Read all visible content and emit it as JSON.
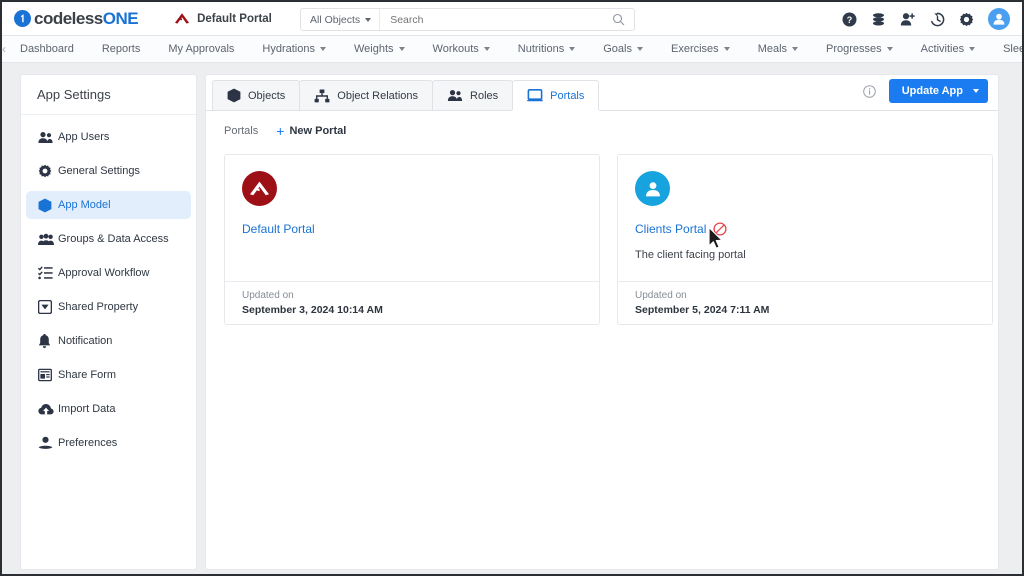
{
  "header": {
    "brand_prefix": "codeless",
    "brand_suffix": "ONE",
    "brand_mark": "1",
    "portal_name": "Default Portal",
    "portal_icon": "arrow-logo-icon",
    "search": {
      "scope": "All Objects",
      "placeholder": "Search",
      "value": "",
      "icon": "search-icon"
    },
    "icons": [
      {
        "name": "help-icon",
        "label": "Help"
      },
      {
        "name": "database-icon",
        "label": "Data"
      },
      {
        "name": "add-user-icon",
        "label": "Add User"
      },
      {
        "name": "history-icon",
        "label": "History"
      },
      {
        "name": "gear-icon",
        "label": "Settings"
      },
      {
        "name": "avatar-icon",
        "label": "Account"
      }
    ]
  },
  "nav": {
    "prev_arrow": "‹",
    "next_arrow": "›",
    "items": [
      {
        "label": "Dashboard",
        "dropdown": false
      },
      {
        "label": "Reports",
        "dropdown": false
      },
      {
        "label": "My Approvals",
        "dropdown": false
      },
      {
        "label": "Hydrations",
        "dropdown": true
      },
      {
        "label": "Weights",
        "dropdown": true
      },
      {
        "label": "Workouts",
        "dropdown": true
      },
      {
        "label": "Nutritions",
        "dropdown": true
      },
      {
        "label": "Goals",
        "dropdown": true
      },
      {
        "label": "Exercises",
        "dropdown": true
      },
      {
        "label": "Meals",
        "dropdown": true
      },
      {
        "label": "Progresses",
        "dropdown": true
      },
      {
        "label": "Activities",
        "dropdown": true
      },
      {
        "label": "Sleeps",
        "dropdown": false
      }
    ]
  },
  "sidebar": {
    "title": "App Settings",
    "items": [
      {
        "label": "App Users",
        "icon": "users-icon",
        "active": false
      },
      {
        "label": "General Settings",
        "icon": "gear-icon",
        "active": false
      },
      {
        "label": "App Model",
        "icon": "cube-icon",
        "active": true
      },
      {
        "label": "Groups & Data Access",
        "icon": "group-access-icon",
        "active": false
      },
      {
        "label": "Approval Workflow",
        "icon": "checklist-icon",
        "active": false
      },
      {
        "label": "Shared Property",
        "icon": "shared-property-icon",
        "active": false
      },
      {
        "label": "Notification",
        "icon": "bell-icon",
        "active": false
      },
      {
        "label": "Share Form",
        "icon": "share-form-icon",
        "active": false
      },
      {
        "label": "Import Data",
        "icon": "cloud-upload-icon",
        "active": false
      },
      {
        "label": "Preferences",
        "icon": "preferences-icon",
        "active": false
      }
    ]
  },
  "main": {
    "tabs": [
      {
        "label": "Objects",
        "icon": "cube-icon",
        "active": false
      },
      {
        "label": "Object Relations",
        "icon": "relations-icon",
        "active": false
      },
      {
        "label": "Roles",
        "icon": "roles-icon",
        "active": false
      },
      {
        "label": "Portals",
        "icon": "portal-screen-icon",
        "active": true
      }
    ],
    "info_icon": "info-icon",
    "update_button": {
      "label": "Update App",
      "caret": "dropdown-caret-icon"
    },
    "breadcrumb": "Portals",
    "new_portal": {
      "label": "New Portal",
      "icon": "plus-icon"
    },
    "footer_label": "Updated on",
    "cards": [
      {
        "name": "Default Portal",
        "description": "",
        "icon": "arrow-logo-icon",
        "icon_bg": "#9d1016",
        "updated_label": "Updated on",
        "updated_value": "September 3, 2024 10:14 AM",
        "blocked": false
      },
      {
        "name": "Clients Portal",
        "description": "The client facing portal",
        "icon": "person-icon",
        "icon_bg": "#17a3dd",
        "updated_label": "Updated on",
        "updated_value": "September 5, 2024 7:11 AM",
        "blocked": true,
        "blocked_icon": "block-icon"
      }
    ]
  },
  "colors": {
    "accent_blue": "#1a73d4",
    "button_blue": "#1a7cf0",
    "block_red": "#e8454a",
    "page_bg": "#eceef0"
  }
}
